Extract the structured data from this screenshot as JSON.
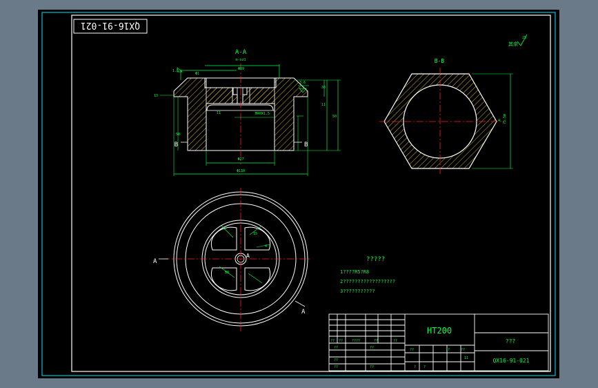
{
  "drawing_code": "QX16-91-021",
  "section_aa_label": "A-A",
  "section_aa_sub": "m-oz1",
  "section_bb_label": "B-B",
  "roughness_note": "其余",
  "roughness_value": "25",
  "dims": {
    "d_top": "Φ1",
    "d_inner_top": "Φ89",
    "thread": "M40X1.5",
    "d_bore": "Φ27",
    "d_base": "Φ110",
    "len_right": "30",
    "len_mid": "11",
    "len_total": "50",
    "len_inner": "11",
    "chamfer_left": "1.5",
    "chamfer_right": "3.6",
    "side_left": "13",
    "side_left2": "50",
    "hex_size": "75.5m",
    "hex_tick": "4"
  },
  "markers": {
    "b_left": "B",
    "b_right": "B",
    "a_left": "A",
    "a_center": "A",
    "a_arrow": "A"
  },
  "plan_dims": {
    "p1": "4",
    "p2": "15",
    "p3": "4",
    "p4": "88"
  },
  "notes": {
    "title": "?????",
    "lines": [
      "1????R5?R8",
      "2??????????????????",
      "3???????????"
    ]
  },
  "title_block": {
    "material": "HT200",
    "part_name": "???",
    "drawing_no": "QX16-91-021",
    "cells": [
      "??",
      "??",
      "????",
      "??",
      "??",
      "??",
      "??",
      "??",
      "??",
      "??",
      "??",
      "??",
      "??",
      "?",
      "?",
      "11"
    ]
  },
  "colors": {
    "outer_bg": "#6b7a88",
    "sheet": "#000000",
    "frame": "#00e5ff",
    "lines": "#ffffff",
    "center": "#ff2020",
    "dim": "#00ff44",
    "hatch": "#e8c830",
    "callout": "#1e5cff"
  }
}
